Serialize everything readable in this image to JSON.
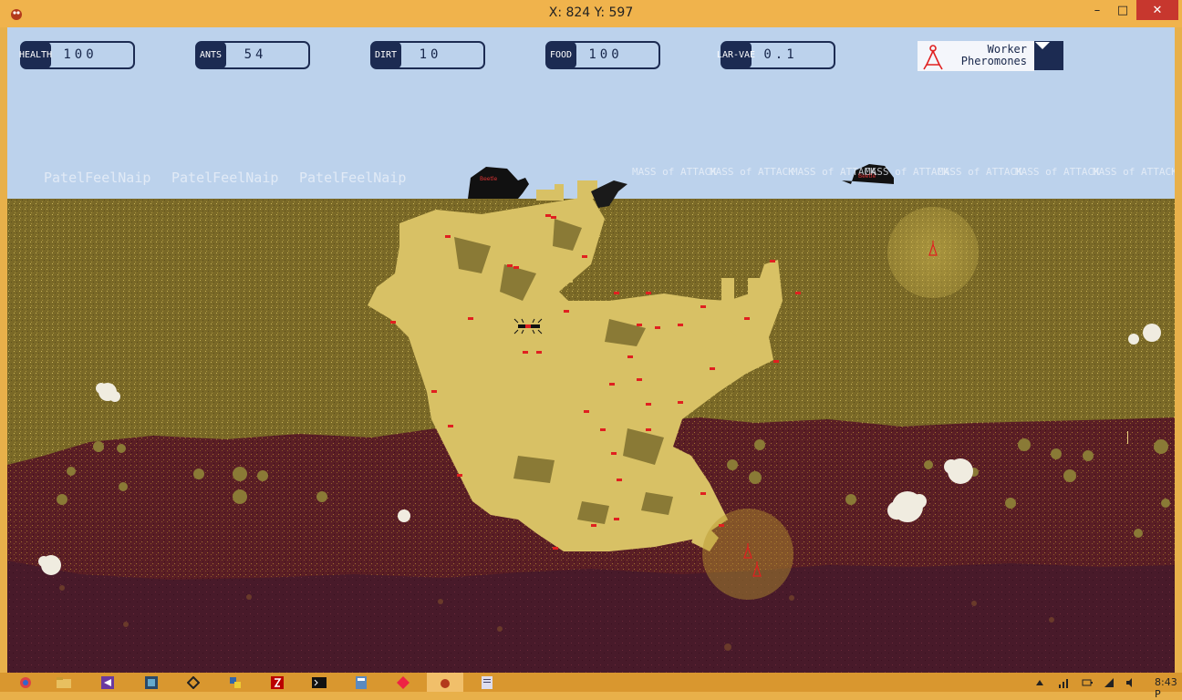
{
  "window": {
    "title": "X: 824 Y: 597",
    "minimize_glyph": "–",
    "maximize_glyph": "□",
    "close_glyph": "✕"
  },
  "hud": {
    "health": {
      "label": "HEALTH",
      "value": "100"
    },
    "ants": {
      "label": "ANTS",
      "value": "54"
    },
    "dirt": {
      "label": "DIRT",
      "value": "10"
    },
    "food": {
      "label": "FOOD",
      "value": "100"
    },
    "larvae": {
      "label_line1": "LAR-",
      "label_line2": "VAE",
      "value": "0.1"
    },
    "pheromones": {
      "line1": "Worker",
      "line2": "Pheromones"
    }
  },
  "signs": [
    "PatelFeelNaip",
    "PatelFeelNaip",
    "PatelFeelNaip",
    "MASS of ATTACK",
    "MASS of ATTACK",
    "MASS of ATTACK",
    "MASS of ATTACK",
    "MASS of ATTACK",
    "MASS of ATTACK",
    "MASS of ATTACK"
  ],
  "beetle_labels": [
    "Beetle",
    "Beetle"
  ],
  "taskbar": {
    "clock": "8:43 P",
    "icons": [
      "chrome-icon",
      "file-explorer-icon",
      "visual-studio-icon",
      "pycharm-icon",
      "unity-icon",
      "python-icon",
      "filezilla-icon",
      "terminal-icon",
      "calculator-icon",
      "git-icon",
      "ant-game-icon",
      "notepad-icon"
    ]
  },
  "colors": {
    "sky": "#bcd2ec",
    "topsoil": "#7a6927",
    "tunnel": "#d8c165",
    "deep_soil": "#5a1e25",
    "bedrock": "#481a2a",
    "hud_dark": "#1c2b52",
    "ant_red": "#e02020",
    "window_frame": "#f0b34c"
  }
}
